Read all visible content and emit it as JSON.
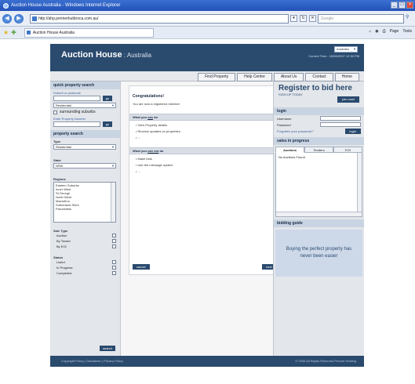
{
  "browser": {
    "window_title": "Auction House Australia - Windows Internet Explorer",
    "address": "http://ahp.pennerbutbroca.com.au/",
    "search_placeholder": "Google",
    "tab_title": "Auction House Australia",
    "cmd_page": "Page",
    "cmd_tools": "Tools"
  },
  "site": {
    "logo_main": "Auction House",
    "logo_sep": " : ",
    "logo_region": "Australia",
    "region_select": "Australia",
    "current_time": "Current Time : 15/06/2007 12:30 PM",
    "nav": [
      "Find Property",
      "Help Centre",
      "About Us",
      "Contact",
      "Home"
    ]
  },
  "left": {
    "quick_search": "quick property search",
    "suburb_label": "Suburb or postcode",
    "go": "go",
    "res_select": "Residential",
    "surrounding": "surrounding suburbs",
    "enter_pn": "Enter Property Number",
    "property_search": "property search",
    "type_label": "Type",
    "type_value": "Residential",
    "state_label": "State",
    "state_value": "NSW",
    "regions_label": "Regions",
    "regions": [
      "Eastern Suburbs",
      "Inner West",
      "St George",
      "North West",
      "Macarthur",
      "Sutherland Shire",
      "Parramatta"
    ],
    "sale_type": "Sale Type",
    "sale_types": [
      "Auction",
      "By Tender",
      "By EOI"
    ],
    "status_label": "Status",
    "statuses": [
      "Listed",
      "In Progress",
      "Completed"
    ],
    "search": "search"
  },
  "main": {
    "congrats": "Congratulations!",
    "registered": "You are now a registered member",
    "can_prefix": "What you ",
    "can_word": "can",
    "can_suffix": " do",
    "can_items": [
      "View Property details",
      "Receive updates on properties",
      "..."
    ],
    "cannot_prefix": "What you ",
    "cannot_word": "can not",
    "cannot_suffix": " do",
    "cannot_items": [
      "Make bids",
      "Use the message system",
      "..."
    ],
    "cancel": "cancel",
    "next": "next »"
  },
  "right": {
    "register_title": "Register to bid here",
    "signup": "SIGN UP TODAY",
    "join": "join now!",
    "login_head": "login",
    "username": "Username",
    "password": "Password",
    "forgot": "Forgotten your password?",
    "login_btn": "login",
    "sales_head": "sales in progress",
    "tabs": [
      "Auctions",
      "Tenders",
      "EOI"
    ],
    "no_auctions": "No Auctions Found",
    "bidding_guide": "bidding guide",
    "guide_text": "Buying the perfect property has never been easier"
  },
  "footer": {
    "left": "Copyright Policy  |  Disclaimer  |  Privacy Policy",
    "right": "© 2006 All Rights Reserved  Penner Hosting"
  }
}
